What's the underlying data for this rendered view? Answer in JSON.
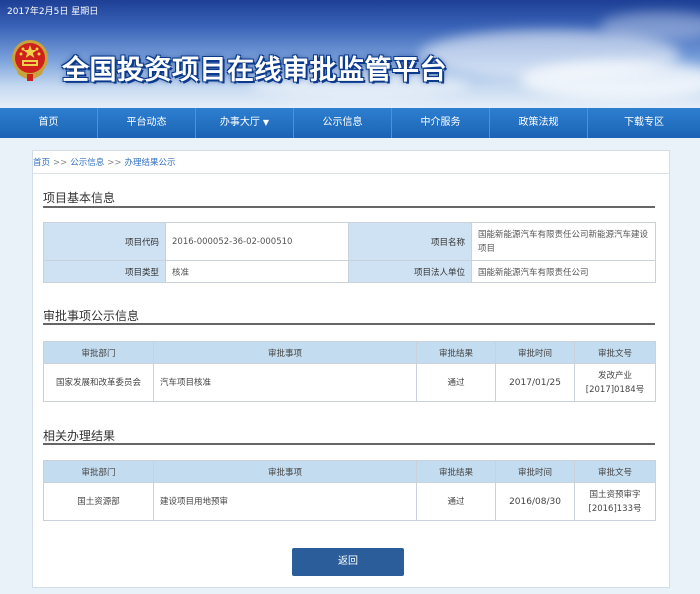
{
  "header": {
    "date": "2017年2月5日 星期日",
    "title": "全国投资项目在线审批监管平台"
  },
  "nav": [
    {
      "label": "首页"
    },
    {
      "label": "平台动态"
    },
    {
      "label": "办事大厅",
      "has_dropdown": true
    },
    {
      "label": "公示信息"
    },
    {
      "label": "中介服务"
    },
    {
      "label": "政策法规"
    },
    {
      "label": "下载专区"
    }
  ],
  "breadcrumb": {
    "home": "首页",
    "level1": "公示信息",
    "level2": "办理结果公示",
    "separator": ">>"
  },
  "basic_info": {
    "title": "项目基本信息",
    "code_label": "项目代码",
    "code_value": "2016-000052-36-02-000510",
    "name_label": "项目名称",
    "name_value": "国能新能源汽车有限责任公司新能源汽车建设项目",
    "type_label": "项目类型",
    "type_value": "核准",
    "entity_label": "项目法人单位",
    "entity_value": "国能新能源汽车有限责任公司"
  },
  "approval_info": {
    "title": "审批事项公示信息",
    "columns": [
      "审批部门",
      "审批事项",
      "审批结果",
      "审批时间",
      "审批文号"
    ],
    "rows": [
      {
        "dept": "国家发展和改革委员会",
        "item": "汽车项目核准",
        "result": "通过",
        "date": "2017/01/25",
        "doc_line1": "发改产业",
        "doc_line2": "[2017]0184号"
      }
    ]
  },
  "related_results": {
    "title": "相关办理结果",
    "columns": [
      "审批部门",
      "审批事项",
      "审批结果",
      "审批时间",
      "审批文号"
    ],
    "rows": [
      {
        "dept": "国土资源部",
        "item": "建设项目用地预审",
        "result": "通过",
        "date": "2016/08/30",
        "doc_line1": "国土资预审字",
        "doc_line2": "[2016]133号"
      }
    ]
  },
  "actions": {
    "back_label": "返回"
  },
  "colors": {
    "nav_bg": "#1b63b4",
    "label_cell_bg": "#cfe2f3",
    "header_cell_bg": "#c4dcef",
    "back_button_bg": "#2a5d99",
    "link": "#2f6fc4"
  }
}
